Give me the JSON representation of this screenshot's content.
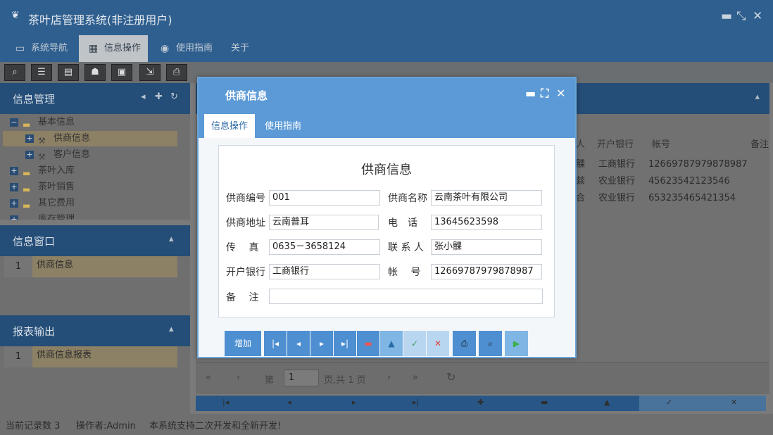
{
  "app": {
    "title": "茶叶店管理系统(非注册用户)",
    "window_controls": [
      "minimize-icon",
      "restore-icon",
      "close-icon"
    ]
  },
  "menu": {
    "tabs": [
      {
        "label": "系统导航",
        "icon": "monitor-icon"
      },
      {
        "label": "信息操作",
        "icon": "grid-icon",
        "active": true
      },
      {
        "label": "使用指南",
        "icon": "help-icon"
      },
      {
        "label": "关于",
        "icon": ""
      }
    ]
  },
  "sidebar": {
    "info_mgmt": {
      "title": "信息管理",
      "tree": [
        {
          "label": "基本信息",
          "type": "folder",
          "expanded": true
        },
        {
          "label": "供商信息",
          "type": "leaf",
          "selected": true
        },
        {
          "label": "客户信息",
          "type": "leaf"
        },
        {
          "label": "茶叶入库",
          "type": "folder"
        },
        {
          "label": "茶叶销售",
          "type": "folder"
        },
        {
          "label": "其它费用",
          "type": "folder"
        },
        {
          "label": "库存管理",
          "type": "folder"
        }
      ]
    },
    "info_window": {
      "title": "信息窗口",
      "rows": [
        {
          "num": "1",
          "label": "供商信息"
        }
      ]
    },
    "report": {
      "title": "报表输出",
      "rows": [
        {
          "num": "1",
          "label": "供商信息报表"
        }
      ]
    }
  },
  "grid": {
    "headers": [
      "人",
      "开户银行",
      "帐号",
      "备注"
    ],
    "rows": [
      [
        "髁",
        "工商银行",
        "12669787979878987"
      ],
      [
        "燚",
        "农业银行",
        "45623542123546"
      ],
      [
        "合",
        "农业银行",
        "653235465421354"
      ]
    ]
  },
  "pager": {
    "page_label": "第",
    "page_value": "1",
    "total_label": "页,共 1 页"
  },
  "status": {
    "record_count": "当前记录数 3",
    "operator": "操作者:Admin",
    "message": "本系统支持二次开发和全新开发!"
  },
  "modal": {
    "title": "供商信息",
    "tabs": [
      "信息操作",
      "使用指南"
    ],
    "form_title": "供商信息",
    "fields": {
      "supplier_id": {
        "label": "供商编号",
        "value": "001"
      },
      "supplier_name": {
        "label": "供商名称",
        "value": "云南茶叶有限公司"
      },
      "address": {
        "label": "供商地址",
        "value": "云南普耳"
      },
      "phone": {
        "label": "电　话",
        "value": "13645623598"
      },
      "fax": {
        "label": "传　 真",
        "value": "0635－3658124"
      },
      "contact": {
        "label": "联 系 人",
        "value": "张小髁"
      },
      "bank": {
        "label": "开户银行",
        "value": "工商银行"
      },
      "account": {
        "label": "帐　 号",
        "value": "12669787979878987"
      },
      "remark": {
        "label": "备　 注",
        "value": ""
      }
    },
    "buttons": {
      "add": "增加"
    }
  }
}
